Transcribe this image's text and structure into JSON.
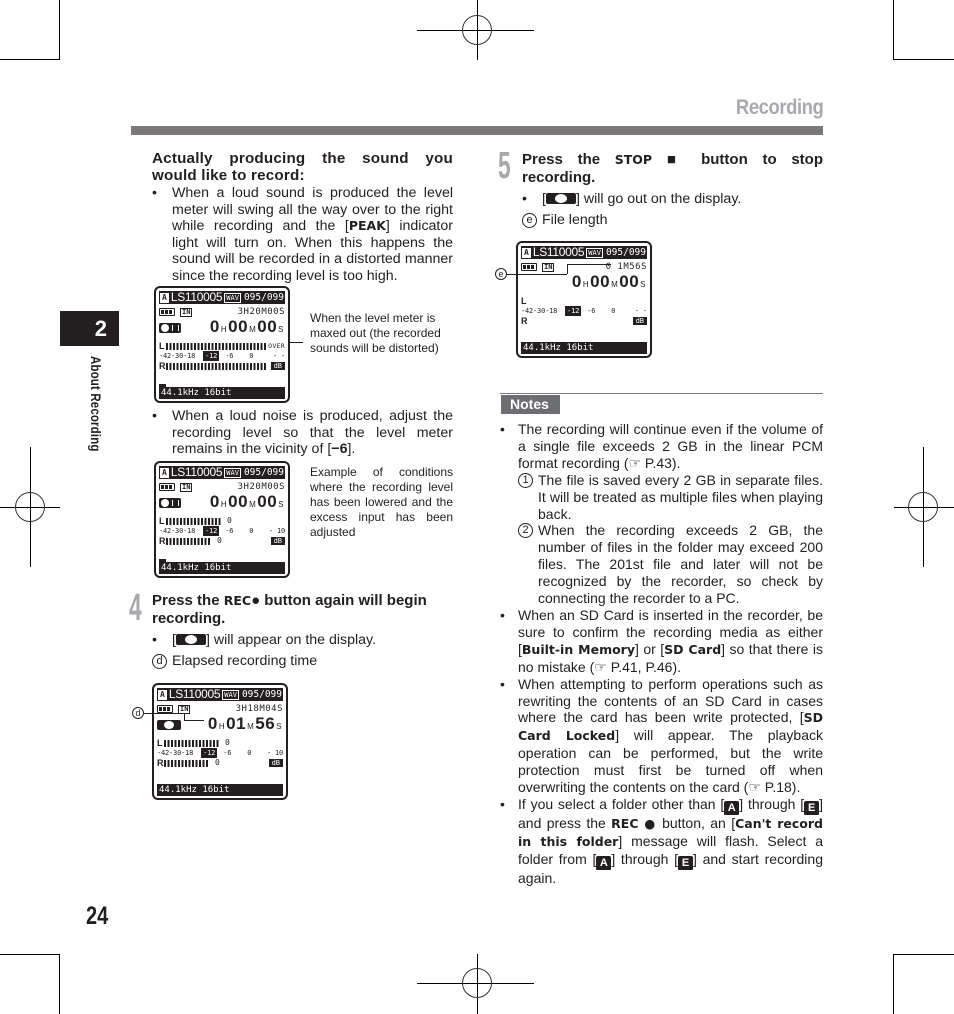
{
  "header": {
    "section_title": "Recording",
    "chapter_number": "2",
    "chapter_label": "About Recording",
    "page_number": "24"
  },
  "left": {
    "heading": "Actually producing the sound you would like to record:",
    "bullet1": {
      "pre": "When a loud sound is produced the level meter will swing all the way over to the right while recording and the [",
      "bold": "PEAK",
      "post": "] indicator light will turn on. When this happens the sound will be recorded in a distorted manner since the recording level is too high."
    },
    "caption1": "When the level meter is maxed out (the recorded sounds will be distorted)",
    "bullet2": {
      "pre": "When a loud noise is produced, adjust the recording level so that the level meter remains in the vicinity of [",
      "bold": "−6",
      "post": "]."
    },
    "caption2": "Example of conditions where the recording level has been lowered and the excess input has been adjusted",
    "step4": {
      "number": "4",
      "title_pre": "Press the ",
      "title_key": "REC",
      "title_post": "● button again will begin recording.",
      "bullet_pre": "[",
      "bullet_post": "] will appear on the display.",
      "callout_letter": "d",
      "callout_text": "Elapsed recording time"
    }
  },
  "right": {
    "step5": {
      "number": "5",
      "title_pre": "Press the ",
      "title_key": "STOP",
      "title_post": " ■ button to stop recording.",
      "bullet_pre": "[",
      "bullet_post": "] will go out on the display.",
      "callout_letter": "e",
      "callout_text": "File length"
    },
    "notes_label": "Notes",
    "notes": {
      "n1": "The recording will continue even if the volume of a single file exceeds 2 GB in the linear PCM format recording (☞ P.43).",
      "n1_sub1_num": "1",
      "n1_sub1": "The file is saved every 2 GB in separate files. It will be treated as multiple files when playing back.",
      "n1_sub2_num": "2",
      "n1_sub2": "When the recording exceeds 2 GB, the number of files in the folder may exceed 200 files. The 201st file and later will not be recognized by the recorder, so check by connecting the recorder to a PC.",
      "n2_a": "When an SD Card is inserted in the recorder, be sure to confirm the recording media as either [",
      "n2_b1": "Built-in Memory",
      "n2_c": "] or [",
      "n2_b2": "SD Card",
      "n2_d": "] so that there is no mistake (☞ P.41, P.46).",
      "n3_a": "When attempting to perform operations such as rewriting the contents of an SD Card in cases where the card has been write protected, [",
      "n3_b": "SD Card Locked",
      "n3_c": "] will appear. The playback operation can be performed, but the write protection must first be turned off when overwriting the contents on the card (☞ P.18).",
      "n4_a": "If you select a folder other than [",
      "n4_f1": "A",
      "n4_b": "] through [",
      "n4_f2": "E",
      "n4_c": "] and press the ",
      "n4_rec": "REC ●",
      "n4_d": " button, an [",
      "n4_msg": "Can't record in this folder",
      "n4_e": "] message will flash. Select a folder from [",
      "n4_f": "] through [",
      "n4_g": "] and start recording again."
    }
  },
  "displays": [
    {
      "folder": "A",
      "file": "LS110005",
      "format": "WAV",
      "count": "095/099",
      "input": "IN",
      "remaining": "3H20M00S",
      "state": "pause",
      "h": "0",
      "m": "00",
      "s": "00",
      "level_L": 1.0,
      "level_R": 1.0,
      "peak_label": "OVER",
      "peak_L": "",
      "peak_R": "",
      "scale": "-42-30-18",
      "scale_mark": "-12",
      "scale_rest": "-6    0",
      "scale_tail": "- -",
      "db": "dB",
      "freq": "44.1kHz  16bit",
      "show_folder": true
    },
    {
      "folder": "A",
      "file": "LS110005",
      "format": "WAV",
      "count": "095/099",
      "input": "IN",
      "remaining": "3H20M00S",
      "state": "pause",
      "h": "0",
      "m": "00",
      "s": "00",
      "level_L": 0.55,
      "level_R": 0.45,
      "peak_label": "",
      "peak_L": "0",
      "peak_R": "0",
      "scale": "-42-30-18",
      "scale_mark": "-12",
      "scale_rest": "-6    0",
      "scale_tail": "- 10",
      "db": "dB",
      "freq": "44.1kHz  16bit",
      "show_folder": true
    },
    {
      "folder": "A",
      "file": "LS110005",
      "format": "WAV",
      "count": "095/099",
      "input": "IN",
      "remaining": "3H18M04S",
      "state": "rec",
      "h": "0",
      "m": "01",
      "s": "56",
      "level_L": 0.55,
      "level_R": 0.45,
      "peak_label": "",
      "peak_L": "0",
      "peak_R": "0",
      "scale": "-42-30-18",
      "scale_mark": "-12",
      "scale_rest": "-6    0",
      "scale_tail": "- 10",
      "db": "dB",
      "freq": "44.1kHz  16bit",
      "show_folder": false
    },
    {
      "folder": "A",
      "file": "LS110005",
      "format": "WAV",
      "count": "095/099",
      "input": "IN",
      "remaining": "0 1M56S",
      "state": "none",
      "h": "0",
      "m": "00",
      "s": "00",
      "level_L": 0,
      "level_R": 0,
      "peak_label": "",
      "peak_L": "",
      "peak_R": "",
      "scale": "-42-30-18",
      "scale_mark": "-12",
      "scale_rest": "-6    0",
      "scale_tail": "- -",
      "db": "dB",
      "freq": "44.1kHz  16bit",
      "show_folder": false
    }
  ]
}
